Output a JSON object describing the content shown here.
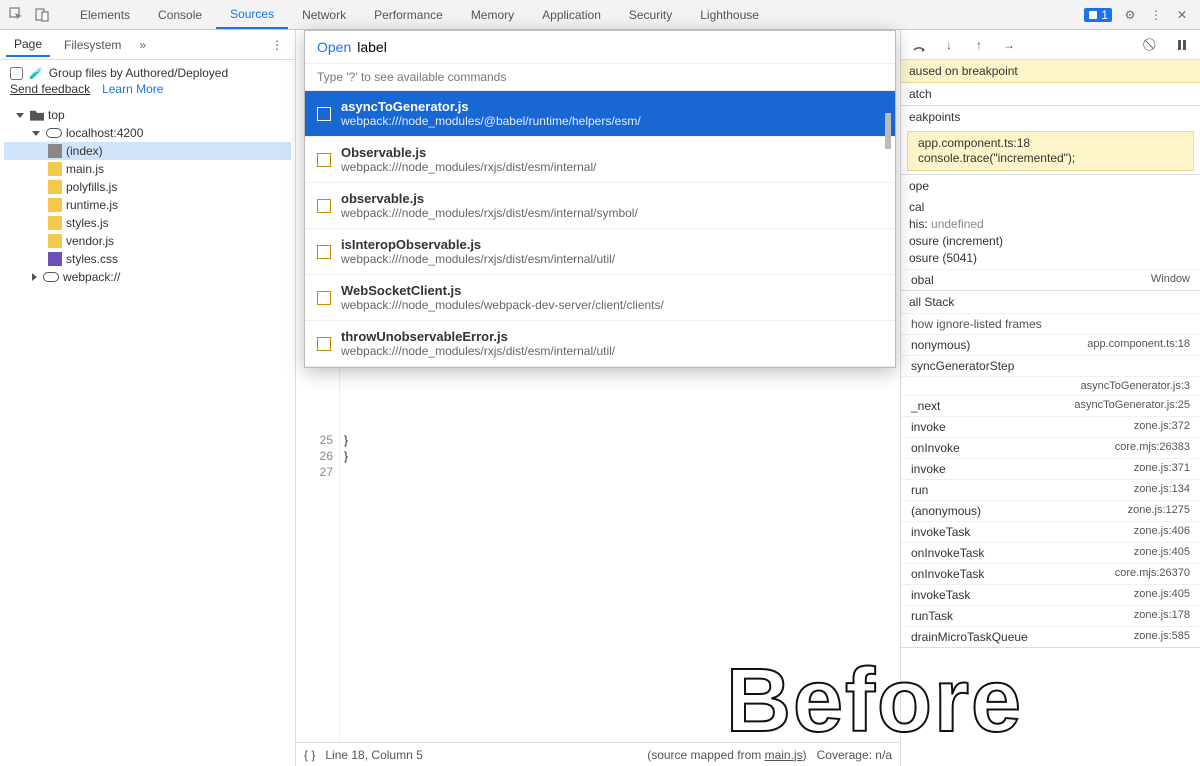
{
  "toolbar": {
    "tabs": [
      "Elements",
      "Console",
      "Sources",
      "Network",
      "Performance",
      "Memory",
      "Application",
      "Security",
      "Lighthouse"
    ],
    "active": 2,
    "badge_count": "1"
  },
  "sidebar": {
    "sub_tabs": [
      "Page",
      "Filesystem"
    ],
    "more": "»",
    "group_label": "Group files by Authored/Deployed",
    "feedback": "Send feedback",
    "learn": "Learn More",
    "tree": [
      {
        "depth": 0,
        "arrow": "down",
        "icon": "folder",
        "label": "top"
      },
      {
        "depth": 1,
        "arrow": "down",
        "icon": "cloud",
        "label": "localhost:4200"
      },
      {
        "depth": 2,
        "arrow": "",
        "icon": "page",
        "label": "(index)",
        "sel": true
      },
      {
        "depth": 2,
        "arrow": "",
        "icon": "js",
        "label": "main.js"
      },
      {
        "depth": 2,
        "arrow": "",
        "icon": "js",
        "label": "polyfills.js"
      },
      {
        "depth": 2,
        "arrow": "",
        "icon": "js",
        "label": "runtime.js"
      },
      {
        "depth": 2,
        "arrow": "",
        "icon": "js",
        "label": "styles.js"
      },
      {
        "depth": 2,
        "arrow": "",
        "icon": "js",
        "label": "vendor.js"
      },
      {
        "depth": 2,
        "arrow": "",
        "icon": "css",
        "label": "styles.css"
      },
      {
        "depth": 1,
        "arrow": "right",
        "icon": "cloud",
        "label": "webpack://"
      }
    ]
  },
  "popup": {
    "prefix": "Open",
    "query": "label",
    "hint": "Type '?' to see available commands",
    "items": [
      {
        "name": "asyncToGenerator.js",
        "path": "webpack:///node_modules/@babel/runtime/helpers/esm/",
        "sel": true
      },
      {
        "name": "Observable.js",
        "path": "webpack:///node_modules/rxjs/dist/esm/internal/"
      },
      {
        "name": "observable.js",
        "path": "webpack:///node_modules/rxjs/dist/esm/internal/symbol/"
      },
      {
        "name": "isInteropObservable.js",
        "path": "webpack:///node_modules/rxjs/dist/esm/internal/util/"
      },
      {
        "name": "WebSocketClient.js",
        "path": "webpack:///node_modules/webpack-dev-server/client/clients/"
      },
      {
        "name": "throwUnobservableError.js",
        "path": "webpack:///node_modules/rxjs/dist/esm/internal/util/"
      }
    ]
  },
  "code": {
    "lines": [
      {
        "n": "25",
        "t": "  }"
      },
      {
        "n": "26",
        "t": "}"
      },
      {
        "n": "27",
        "t": ""
      }
    ]
  },
  "status": {
    "cursor": "Line 18, Column 5",
    "mapped_prefix": "(source mapped from ",
    "mapped_link": "main.js",
    "mapped_suffix": ")",
    "coverage": "Coverage: n/a"
  },
  "debugger": {
    "banner": "aused on breakpoint",
    "watch": "atch",
    "breakpoints": "eakpoints",
    "bp_file": "app.component.ts:18",
    "bp_code": "console.trace(\"incremented\");",
    "scope": "ope",
    "scope_lines": [
      "cal",
      "his: undefined",
      "osure (increment)",
      "osure (5041)"
    ],
    "global_l": "obal",
    "global_r": "Window",
    "callstack": "all Stack",
    "ignore": "how ignore-listed frames",
    "frames": [
      {
        "l": "nonymous)",
        "r": "app.component.ts:18"
      },
      {
        "l": "syncGeneratorStep",
        "r": ""
      },
      {
        "l": "",
        "r": "asyncToGenerator.js:3"
      },
      {
        "l": "_next",
        "r": "asyncToGenerator.js:25"
      },
      {
        "l": "invoke",
        "r": "zone.js:372"
      },
      {
        "l": "onInvoke",
        "r": "core.mjs:26383"
      },
      {
        "l": "invoke",
        "r": "zone.js:371"
      },
      {
        "l": "run",
        "r": "zone.js:134"
      },
      {
        "l": "(anonymous)",
        "r": "zone.js:1275"
      },
      {
        "l": "invokeTask",
        "r": "zone.js:406"
      },
      {
        "l": "onInvokeTask",
        "r": "zone.js:405"
      },
      {
        "l": "onInvokeTask",
        "r": "core.mjs:26370"
      },
      {
        "l": "invokeTask",
        "r": "zone.js:405"
      },
      {
        "l": "runTask",
        "r": "zone.js:178"
      },
      {
        "l": "drainMicroTaskQueue",
        "r": "zone.js:585"
      }
    ]
  },
  "watermark": "Before"
}
